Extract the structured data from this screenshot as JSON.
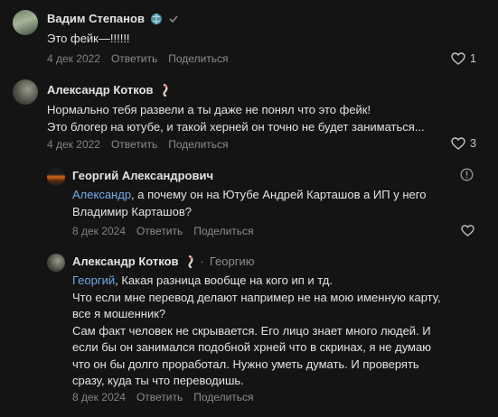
{
  "comments": [
    {
      "author": "Вадим Степанов",
      "lines": [
        "Это фейк—!!!!!!"
      ],
      "date": "4 дек 2022",
      "reply_label": "Ответить",
      "share_label": "Поделиться",
      "likes": "1"
    },
    {
      "author": "Александр Котков",
      "lines": [
        "Нормально тебя развели а ты даже не понял что это фейк!",
        "Это блогер на ютубе, и такой херней он точно не будет заниматься..."
      ],
      "date": "4 дек 2022",
      "reply_label": "Ответить",
      "share_label": "Поделиться",
      "likes": "3"
    },
    {
      "author": "Георгий Александрович",
      "mention": "Александр",
      "line1_rest": ", а почему он на Ютубе Андрей Карташов а ИП у него",
      "line2": "Владимир Карташов?",
      "date": "8 дек 2024",
      "reply_label": "Ответить",
      "share_label": "Поделиться"
    },
    {
      "author": "Александр Котков",
      "reply_to": "Георгию",
      "mention": "Георгий",
      "line1_rest": ", Какая разница вообще на кого ип и тд.",
      "lines": [
        "Что если мне перевод делают например не на мою именную карту,",
        "все я мошенник?",
        "Сам факт человек не скрывается. Его лицо знает много людей. И",
        "если бы он занимался подобной хрней что в скринах, я не думаю",
        "что он бы долго проработал. Нужно уметь думать. И проверять",
        "сразу, куда ты что переводишь."
      ],
      "date": "8 дек 2024",
      "reply_label": "Ответить",
      "share_label": "Поделиться"
    }
  ],
  "colors": {
    "background": "#141414",
    "text": "#e1e3e6",
    "muted": "#828282",
    "link": "#71aaeb"
  }
}
